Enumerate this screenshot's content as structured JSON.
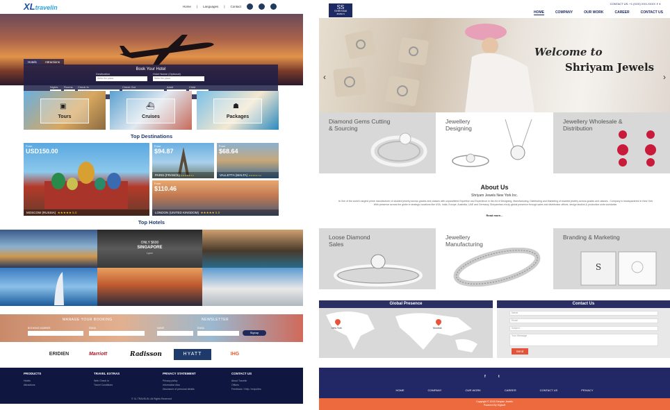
{
  "left_site": {
    "logo": {
      "main": "XL",
      "script": "travelin"
    },
    "nav": [
      "Home",
      "Languages",
      "Contact"
    ],
    "hero": {
      "tabs": [
        "Hotels",
        "Attractions"
      ],
      "title": "Book Your Hotel",
      "fields": {
        "destination": {
          "label": "Destination",
          "placeholder": "Write the place"
        },
        "hotel_name": {
          "label": "Hotel Name (Optional)",
          "placeholder": "Write the place"
        },
        "nights": {
          "label": "Nights",
          "value": "1"
        },
        "rooms": {
          "label": "Rooms",
          "value": "1"
        },
        "check_in": {
          "label": "Check In",
          "value": "MM/DD/YY"
        },
        "check_out": {
          "label": "Check Out",
          "value": "MM/DD/YY"
        },
        "adult": {
          "label": "Adult",
          "value": "1"
        },
        "child": {
          "label": "Child",
          "value": "0"
        }
      },
      "search_button": "Search Now"
    },
    "categories": [
      {
        "label": "Tours",
        "icon": "suitcase-icon",
        "glyph": "▣"
      },
      {
        "label": "Cruises",
        "icon": "ship-icon",
        "glyph": "⛴"
      },
      {
        "label": "Packages",
        "icon": "group-icon",
        "glyph": "☗"
      }
    ],
    "top_destinations": {
      "title": "Top Destinations",
      "items": [
        {
          "from": "From",
          "price": "USD150.00",
          "name": "MOSCOW (RUSSIA)",
          "rating": "★★★★★ 5.0"
        },
        {
          "from": "From",
          "price": "$94.87",
          "name": "PARIS (FRANCE)",
          "rating": "★★★★★ 5.0"
        },
        {
          "from": "From",
          "price": "$68.64",
          "name": "VALLETTA (MALTA)",
          "rating": "★★★★★ 5.0"
        },
        {
          "from": "From",
          "price": "$110.46",
          "name": "LONDON (UNITED KINGDOM)",
          "rating": "★★★★★ 5.0"
        }
      ]
    },
    "top_hotels": {
      "title": "Top Hotels",
      "featured": {
        "line1": "ONLY $600",
        "line2": "SINGAPORE",
        "line3": "Lyon"
      }
    },
    "manage": {
      "title": "MANAGE YOUR BOOKING",
      "booking_label": "BOOKING NUMBER",
      "email_label": "EMAIL",
      "newsletter_title": "NEWSLETTER",
      "name_label": "NAME",
      "nl_email_label": "EMAIL",
      "signup": "Signup"
    },
    "partners": [
      "ERIDIEN",
      "Marriott",
      "Radisson",
      "HYATT",
      "IHG"
    ],
    "footer": {
      "columns": [
        {
          "title": "PRODUCTS",
          "items": [
            "Hotels",
            "Attractions"
          ]
        },
        {
          "title": "TRAVEL EXTRAS",
          "items": [
            "Web Check In",
            "Travel Conditions"
          ]
        },
        {
          "title": "PRIVACY STATEMENT",
          "items": [
            "Privacy policy",
            "Information Also",
            "Disclosure of personal details"
          ]
        },
        {
          "title": "CONTACT US",
          "items": [
            "About Travelin",
            "Offices",
            "Feedback / Help / enquiries"
          ]
        }
      ],
      "copyright": "© XL TRAVELIN. All Rights Reserved"
    }
  },
  "right_site": {
    "logo": {
      "mark": "SS",
      "name": "SHRIYAM",
      "tag": "JEWELS"
    },
    "contact": "CONTACT US: +1 (XXX) XXX-XXXX",
    "nav": [
      "HOME",
      "COMPANY",
      "OUR WORK",
      "CAREER",
      "CONTACT US"
    ],
    "hero": {
      "welcome": "Welcome to",
      "brand": "Shriyam Jewels"
    },
    "boxes_row1": [
      {
        "title": "Diamond Gems Cutting & Sourcing"
      },
      {
        "title": "Jewellery Designing"
      },
      {
        "title": "Jewellery Wholesale & Distribution"
      }
    ],
    "about": {
      "title": "About Us",
      "subtitle": "Shriyam Jewels New York Inc.",
      "text": "Is One of the world's largest prime manufacturer of studded jewelry across grades and classes with unparalleled Expertise and Experience in the Art of Designing, Manufacturing, Distributing and Marketing of studded jewelry across grades and classes . Company is headquartered in New York With presence across the globe in strategic locations like USA, India, Europe, Australia, UAE and Germany, Shriyamhas a truly global presence through sales and distribution offices, design studios & production units worldwide.",
      "read_more": "Read more..."
    },
    "boxes_row2": [
      {
        "title": "Loose Diamond Sales"
      },
      {
        "title": "Jewellery Manufacturing"
      },
      {
        "title": "Branding & Marketing"
      }
    ],
    "global_presence": {
      "title": "Global Presence",
      "pins": [
        "New York",
        "Mumbai"
      ]
    },
    "contact_form": {
      "title": "Contact Us",
      "fields": [
        "Name",
        "Email",
        "Subject",
        "Your Message"
      ],
      "send": "Send"
    },
    "footer": {
      "social": [
        "f",
        "t"
      ],
      "nav": [
        "HOME",
        "COMPANY",
        "OUR WORK",
        "CAREER",
        "CONTACT US",
        "PRIVACY"
      ],
      "copyright": "Copyright © 2015 Shriyam Jewels",
      "powered": "Powered By Digisoft"
    }
  },
  "colors": {
    "navy": "#1d2a63",
    "orange": "#ec6a3e",
    "footer_dark": "#0f1740"
  }
}
